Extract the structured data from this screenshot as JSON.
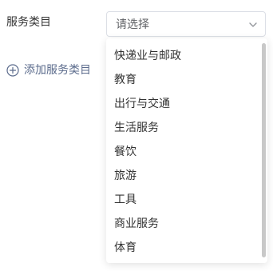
{
  "form": {
    "field_label": "服务类目",
    "select": {
      "placeholder": "请选择",
      "options": [
        "快递业与邮政",
        "教育",
        "出行与交通",
        "生活服务",
        "餐饮",
        "旅游",
        "工具",
        "商业服务",
        "体育"
      ]
    },
    "add_link_label": "添加服务类目"
  },
  "icons": {
    "select_chevron": "chevron-down-icon",
    "add": "plus-circle-icon"
  },
  "colors": {
    "text": "#333333",
    "placeholder": "#606266",
    "link": "#5b6b8c",
    "border": "#dcdfe6",
    "scrollbar": "#c8c8c8"
  }
}
